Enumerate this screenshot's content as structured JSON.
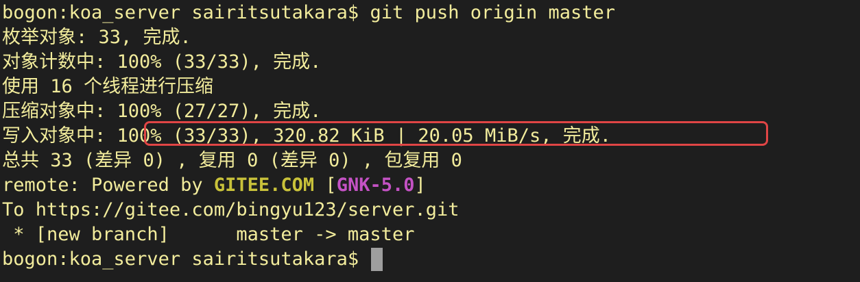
{
  "terminal": {
    "lines": [
      {
        "prompt": "bogon:koa_server sairitsutakara$ ",
        "command": "git push origin master"
      },
      {
        "text": "枚举对象: 33, 完成."
      },
      {
        "text": "对象计数中: 100% (33/33), 完成."
      },
      {
        "text": "使用 16 个线程进行压缩"
      },
      {
        "text": "压缩对象中: 100% (27/27), 完成."
      },
      {
        "label": "写入对象中: ",
        "text": "100% (33/33), 320.82 KiB | 20.05 MiB/s, 完成."
      },
      {
        "text": "总共 33 (差异 0) , 复用 0 (差异 0) , 包复用 0"
      },
      {
        "prefix": "remote: Powered by ",
        "gitee": "GITEE.COM",
        "bracket_open": " [",
        "gnk": "GNK-5.0",
        "bracket_close": "]"
      },
      {
        "text": "To https://gitee.com/bingyu123/server.git"
      },
      {
        "text": " * [new branch]      master -> master"
      },
      {
        "prompt": "bogon:koa_server sairitsutakara$"
      }
    ]
  },
  "colors": {
    "background": "#1e1e1e",
    "text": "#f2ec9c",
    "gitee": "#c9c23a",
    "gnk": "#c452c4",
    "highlight": "#e04545",
    "cursor": "#9e9e9e"
  }
}
